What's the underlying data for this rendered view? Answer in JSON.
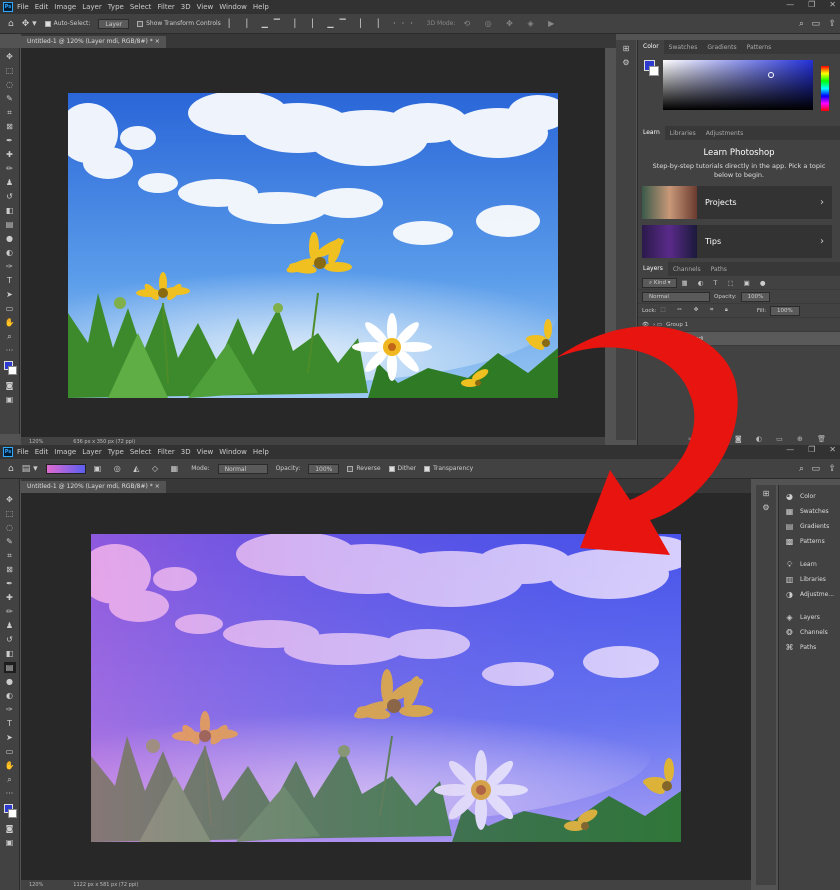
{
  "menu": [
    "File",
    "Edit",
    "Image",
    "Layer",
    "Type",
    "Select",
    "Filter",
    "3D",
    "View",
    "Window",
    "Help"
  ],
  "logo": "Ps",
  "top": {
    "options": {
      "auto_select": "Auto-Select:",
      "layer_select": "Layer",
      "transform": "Show Transform Controls",
      "mode3d": "3D Mode:"
    },
    "tab": "Untitled-1 @ 120% (Layer mdi, RGB/8#) *",
    "status": {
      "zoom": "120%",
      "dims": "636 px x 350 px (72 ppi)"
    },
    "color_tabs": [
      "Color",
      "Swatches",
      "Gradients",
      "Patterns"
    ],
    "learn_tabs": [
      "Learn",
      "Libraries",
      "Adjustments"
    ],
    "learn_title": "Learn Photoshop",
    "learn_desc": "Step-by-step tutorials directly in the app. Pick a topic below to begin.",
    "learn_items": [
      "Projects",
      "Tips"
    ],
    "layers_tabs": [
      "Layers",
      "Channels",
      "Paths"
    ],
    "layers": {
      "kind": "Kind",
      "blend": "Normal",
      "opacity_label": "Opacity:",
      "opacity": "100%",
      "lock_label": "Lock:",
      "fill_label": "Fill:",
      "fill": "100%",
      "group": "Group 1",
      "layer": "Layer mdi"
    }
  },
  "bottom": {
    "options": {
      "mode_label": "Mode:",
      "mode": "Normal",
      "opacity_label": "Opacity:",
      "opacity": "100%",
      "reverse": "Reverse",
      "dither": "Dither",
      "transparency": "Transparency"
    },
    "tab": "Untitled-1 @ 120% (Layer mdi, RGB/8#) *",
    "status": {
      "zoom": "120%",
      "dims": "1122 px x 581 px (72 ppi)"
    },
    "dock": [
      "Color",
      "Swatches",
      "Gradients",
      "Patterns",
      "Learn",
      "Libraries",
      "Adjustme...",
      "Layers",
      "Channels",
      "Paths"
    ]
  },
  "colors": {
    "arrow": "#e8140f",
    "ps_bg": "#535353",
    "accent": "#2d6bd8"
  }
}
